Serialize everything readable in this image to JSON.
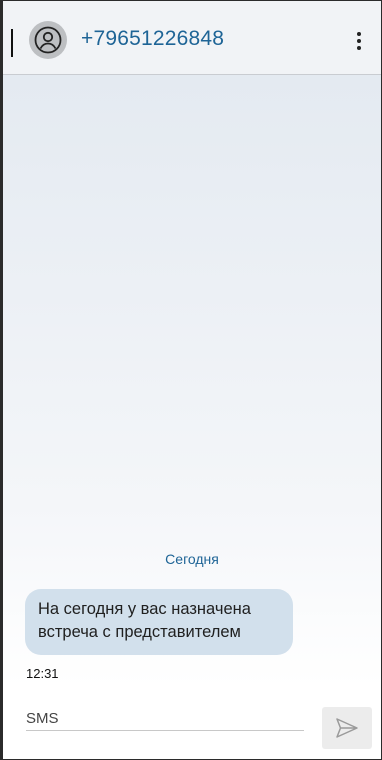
{
  "header": {
    "phone_number": "+79651226848",
    "avatar_icon": "person-circle-icon",
    "menu_icon": "more-vertical-icon"
  },
  "conversation": {
    "date_separator": "Сегодня",
    "messages": [
      {
        "text": "На сегодня у вас назначена встреча с представителем",
        "time": "12:31",
        "direction": "incoming"
      }
    ]
  },
  "composer": {
    "placeholder": "SMS",
    "value": "",
    "send_icon": "send-icon"
  },
  "colors": {
    "accent": "#1e6496",
    "bubble_bg": "#d2e0ec",
    "header_bg": "#f1f3f6"
  }
}
